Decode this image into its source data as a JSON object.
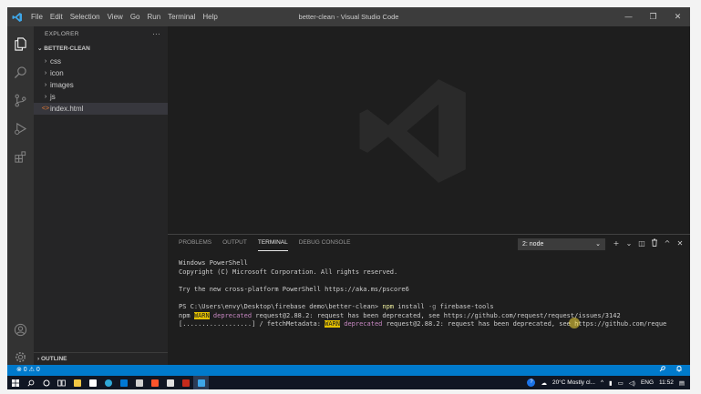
{
  "window": {
    "title": "better-clean - Visual Studio Code",
    "menu": [
      "File",
      "Edit",
      "Selection",
      "View",
      "Go",
      "Run",
      "Terminal",
      "Help"
    ],
    "controls": {
      "minimize": "—",
      "restore": "❐",
      "close": "✕"
    }
  },
  "activity_bar": [
    "explorer-icon",
    "search-icon",
    "source-control-icon",
    "run-debug-icon",
    "extensions-icon",
    "accounts-icon",
    "manage-gear-icon"
  ],
  "explorer": {
    "header": "EXPLORER",
    "more": "···",
    "root": "BETTER-CLEAN",
    "items": [
      {
        "label": "css",
        "type": "folder"
      },
      {
        "label": "icon",
        "type": "folder"
      },
      {
        "label": "images",
        "type": "folder"
      },
      {
        "label": "js",
        "type": "folder"
      },
      {
        "label": "index.html",
        "type": "file",
        "active": true
      }
    ],
    "outline": "OUTLINE"
  },
  "panel": {
    "tabs": [
      "PROBLEMS",
      "OUTPUT",
      "TERMINAL",
      "DEBUG CONSOLE"
    ],
    "active_tab": "TERMINAL",
    "terminal_select": "2: node",
    "actions": [
      "+",
      "⌄",
      "◫",
      "🗑",
      "^",
      "✕"
    ]
  },
  "terminal": {
    "line1": "Windows PowerShell",
    "line2": "Copyright (C) Microsoft Corporation. All rights reserved.",
    "line3": "Try the new cross-platform PowerShell https://aka.ms/pscore6",
    "prompt": "PS C:\\Users\\envy\\Desktop\\firebase demo\\better-clean> ",
    "cmd": "npm",
    "cmd_args1": " install ",
    "cmd_flag": "-g",
    "cmd_args2": " firebase-tools",
    "warn1_prefix": "npm ",
    "warn_label": "WARN",
    "deprecated": " deprecated ",
    "warn1_text": "request@2.88.2: request has been deprecated, see https://github.com/request/request/issues/3142",
    "progress_prefix": "[..................] / fetchMetadata: ",
    "warn2_text": "request@2.88.2: request has been deprecated, see https://github.com/reque"
  },
  "status_bar": {
    "errors": "⊗ 0 ⚠ 0",
    "right_icons": [
      "feedback-icon",
      "bell-icon"
    ]
  },
  "taskbar": {
    "weather": "20°C  Mostly cl...",
    "lang": "ENG",
    "time": "11:52"
  },
  "colors": {
    "accent": "#007acc",
    "titlebar": "#3c3c3c",
    "sidebar": "#252526",
    "editor": "#1e1e1e",
    "warn": "#e5c100",
    "deprecated": "#c586c0"
  }
}
